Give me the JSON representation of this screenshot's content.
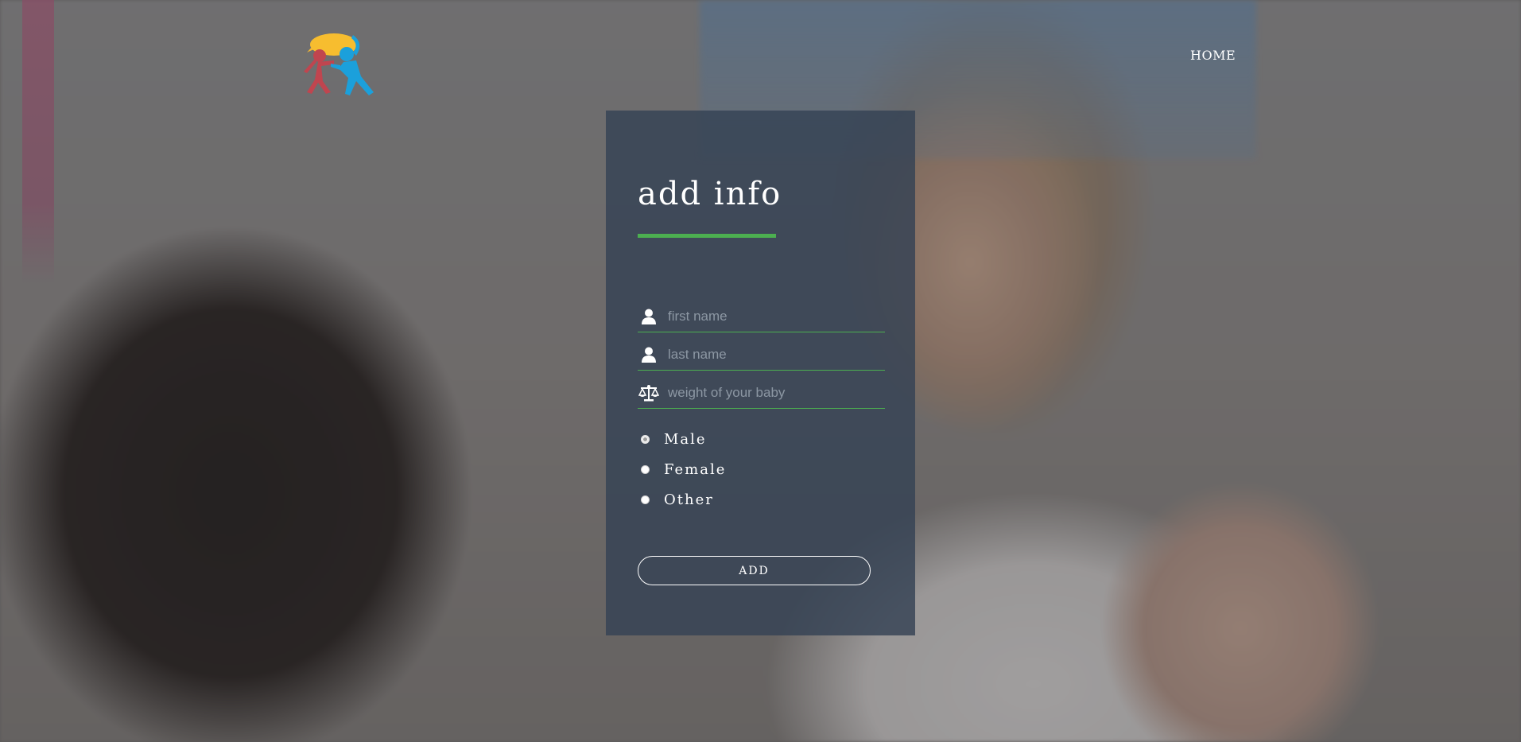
{
  "header": {
    "logo_icon": "family-logo-icon",
    "nav": {
      "home_label": "HOME"
    }
  },
  "form": {
    "title": "add info",
    "accent_color": "#4caf50",
    "fields": {
      "first_name": {
        "icon": "user-icon",
        "placeholder": "first name",
        "value": ""
      },
      "last_name": {
        "icon": "user-icon",
        "placeholder": "last name",
        "value": ""
      },
      "weight": {
        "icon": "scale-icon",
        "placeholder": "weight of your baby",
        "value": ""
      }
    },
    "gender_options": [
      {
        "label": "Male",
        "selected": true
      },
      {
        "label": "Female",
        "selected": false
      },
      {
        "label": "Other",
        "selected": false
      }
    ],
    "submit_label": "ADD"
  }
}
